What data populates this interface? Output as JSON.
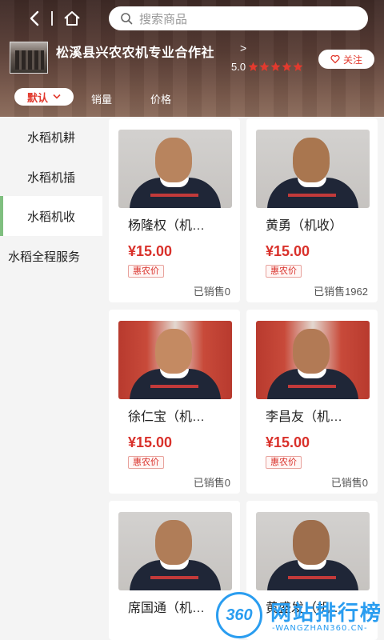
{
  "search": {
    "placeholder": "搜索商品"
  },
  "shop": {
    "name": "松溪县兴农农机专业合作社",
    "arrow": ">",
    "rating": "5.0",
    "stars": 5,
    "follow_label": "关注"
  },
  "sort": {
    "default_label": "默认",
    "sales_label": "销量",
    "price_label": "价格"
  },
  "categories": [
    {
      "label": "水稻机耕",
      "active": false
    },
    {
      "label": "水稻机插",
      "active": false
    },
    {
      "label": "水稻机收",
      "active": true
    },
    {
      "label": "水稻全程服务",
      "active": false
    }
  ],
  "products": [
    {
      "name": "杨隆权（机…",
      "price": "¥15.00",
      "tag": "惠农价",
      "sold": "已销售0"
    },
    {
      "name": "黄勇（机收）",
      "price": "¥15.00",
      "tag": "惠农价",
      "sold": "已销售1962"
    },
    {
      "name": "徐仁宝（机…",
      "price": "¥15.00",
      "tag": "惠农价",
      "sold": "已销售0"
    },
    {
      "name": "李昌友（机…",
      "price": "¥15.00",
      "tag": "惠农价",
      "sold": "已销售0"
    },
    {
      "name": "席国通（机…",
      "price": "",
      "tag": "",
      "sold": ""
    },
    {
      "name": "黄盛发（机…",
      "price": "",
      "tag": "",
      "sold": ""
    }
  ],
  "watermark": {
    "logo": "360",
    "title": "网站排行榜",
    "subtitle": "-WANGZHAN360.CN-"
  },
  "colors": {
    "accent_red": "#d9312b",
    "active_indicator": "#7fbf7f",
    "watermark_blue": "#2a9df0"
  }
}
